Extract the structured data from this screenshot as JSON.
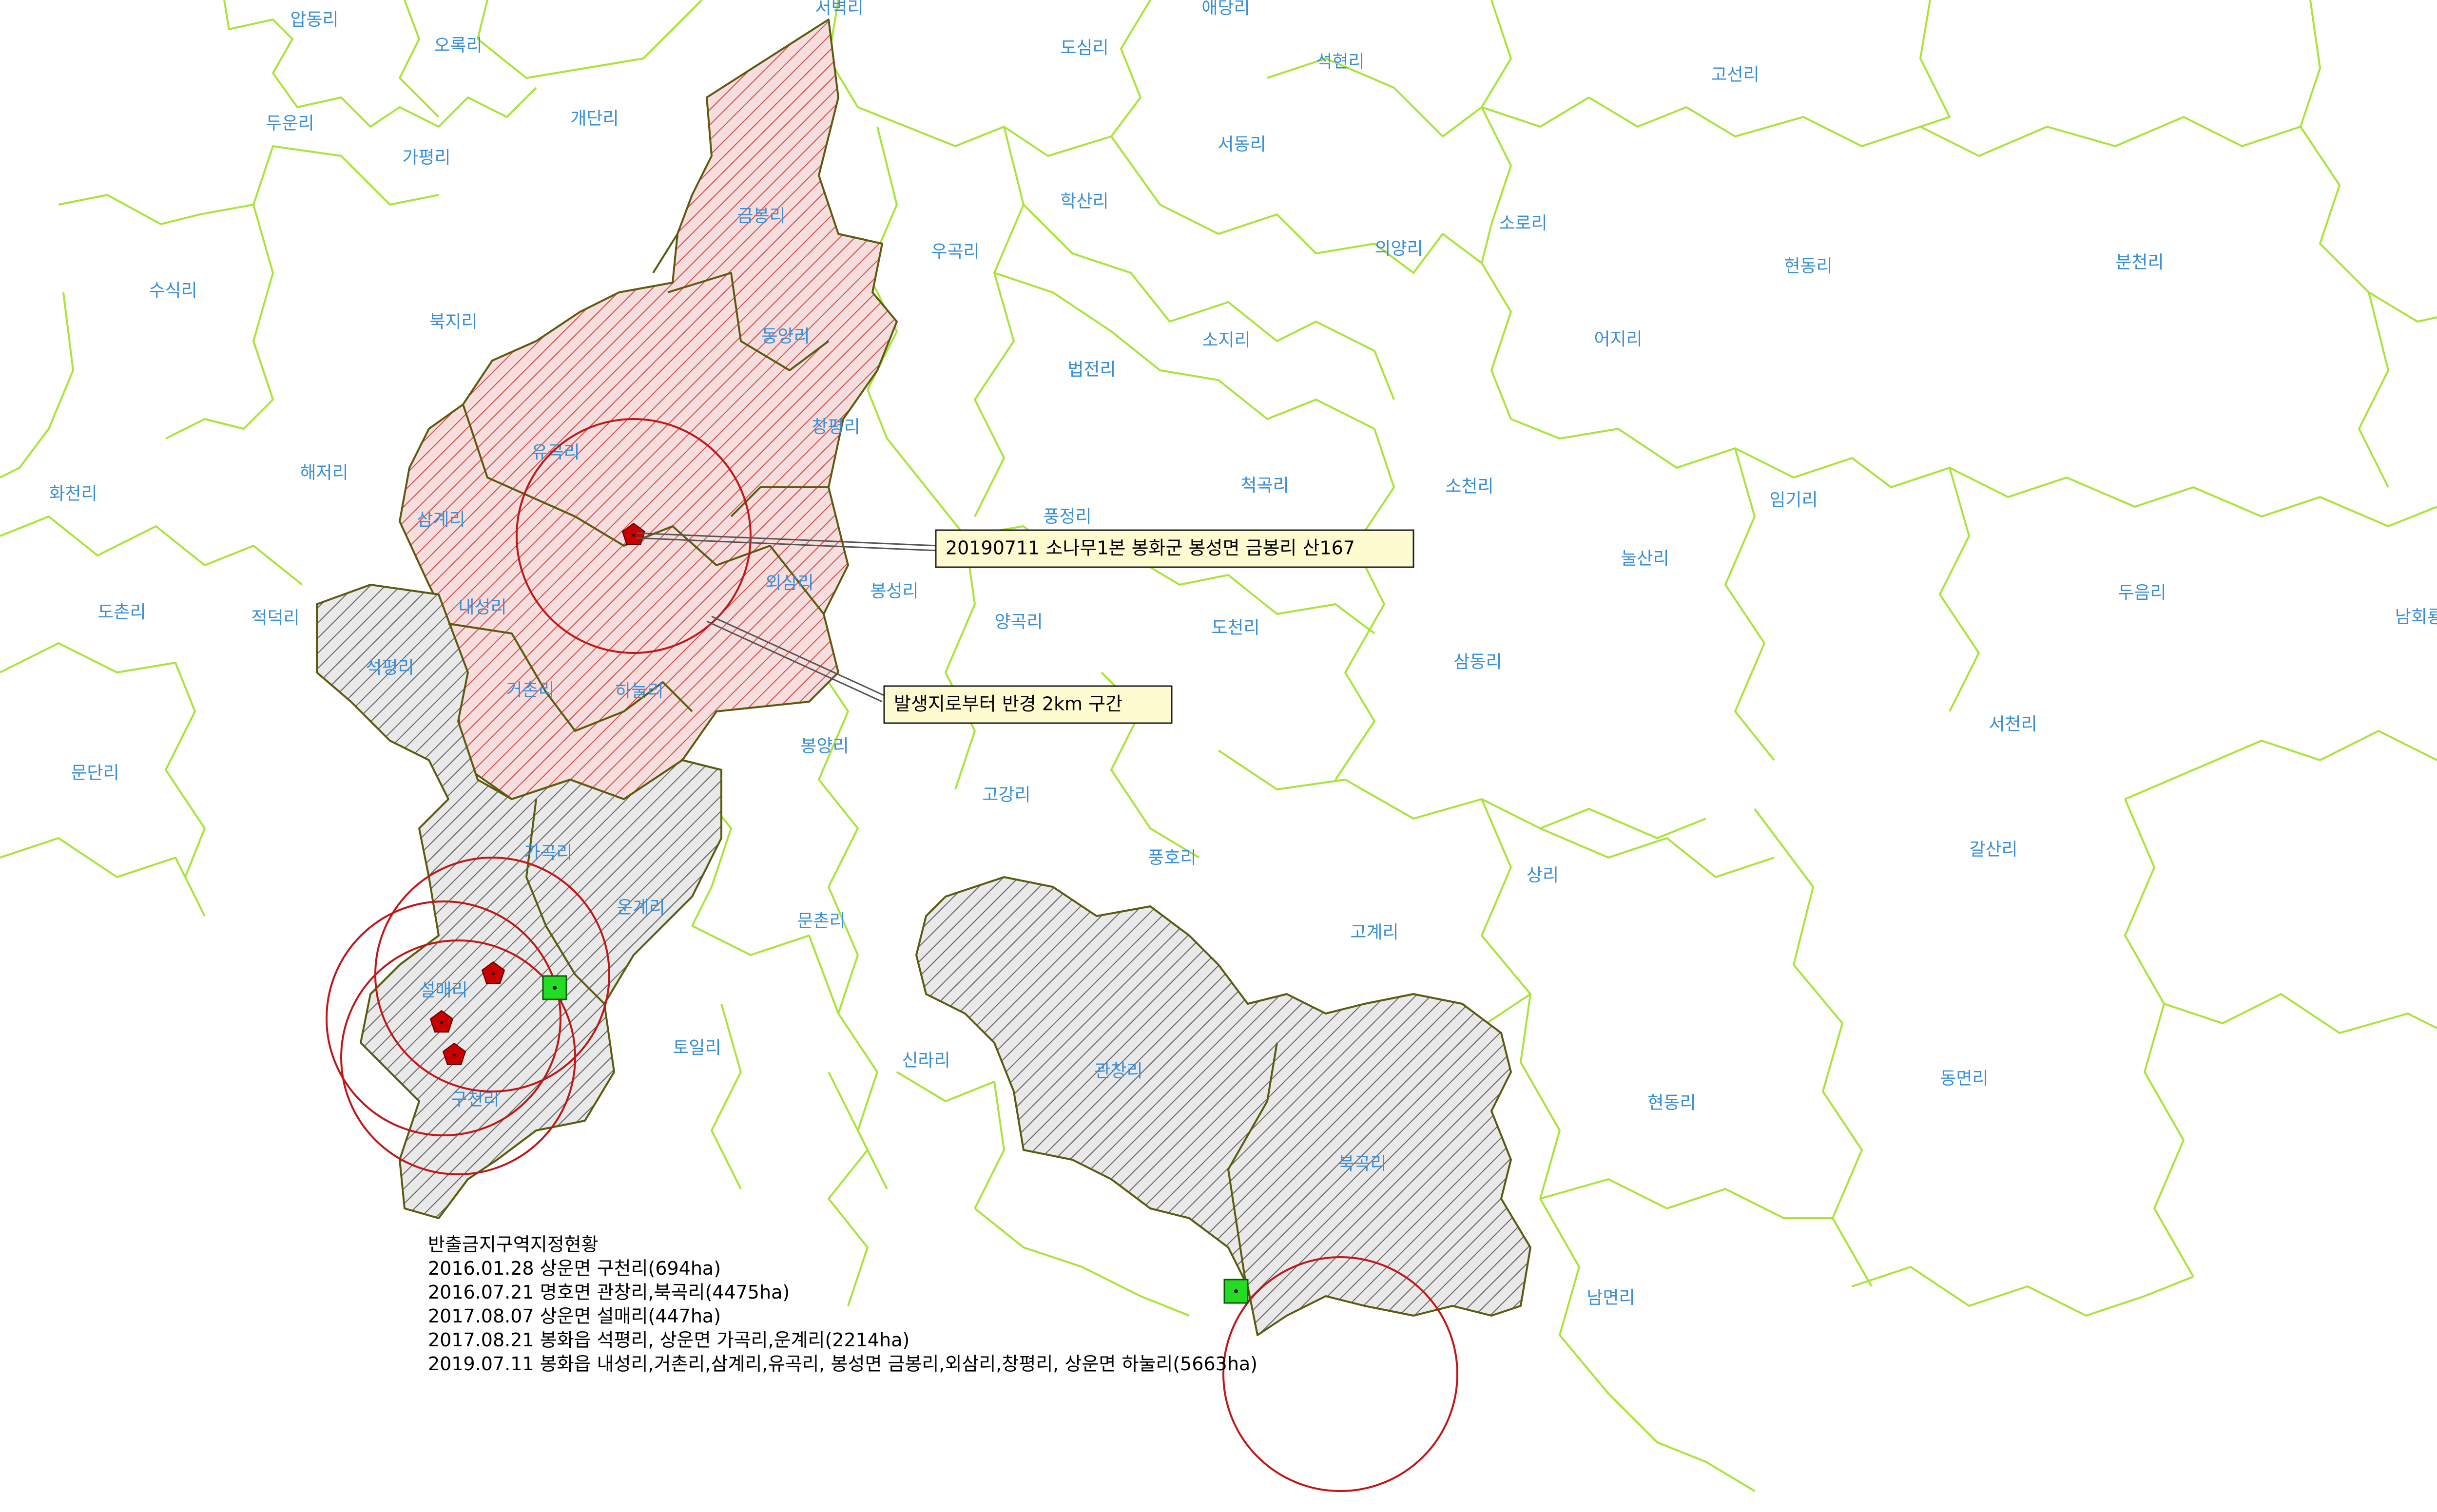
{
  "colors": {
    "boundary": "#a8e43a",
    "hatch_red_fill": "#d84a4a",
    "hatch_red_bg": "#f7dede",
    "hatch_gray_fill": "#666666",
    "hatch_gray_bg": "#e9e9e9",
    "zone_outline": "#5b5b10",
    "radius_circle": "#c01818",
    "occurrence_marker": "#c80000",
    "sample_marker": "#22dd22",
    "village_label": "#3a8fd6"
  },
  "icons": {
    "occurrence": "red-pentagon-icon",
    "sample": "green-square-icon"
  },
  "village_labels": [
    "압동리",
    "오록리",
    "두운리",
    "가평리",
    "개단리",
    "서벽리",
    "애당리",
    "도심리",
    "석현리",
    "서동리",
    "고선리",
    "학산리",
    "우곡리",
    "의양리",
    "소로리",
    "현동리",
    "분천리",
    "수식리",
    "북지리",
    "금봉리",
    "동양리",
    "법전리",
    "소지리",
    "어지리",
    "화천리",
    "해저리",
    "유곡리",
    "창평리",
    "척곡리",
    "소천리",
    "임기리",
    "삼계리",
    "풍정리",
    "도촌리",
    "적덕리",
    "내성리",
    "외삼리",
    "봉성리",
    "양곡리",
    "도천리",
    "눌산리",
    "두음리",
    "남회룡리",
    "석평리",
    "거촌리",
    "하눌리",
    "삼동리",
    "문단리",
    "봉양리",
    "고강리",
    "서천리",
    "가곡리",
    "풍호리",
    "갈산리",
    "운계리",
    "문촌리",
    "상리",
    "고계리",
    "설매리",
    "토일리",
    "신라리",
    "관창리",
    "현동리",
    "동면리",
    "구천리",
    "북곡리",
    "남면리"
  ],
  "callouts": [
    {
      "text": "20190711 소나무1본 봉화군 봉성면 금봉리 산167"
    },
    {
      "text": "발생지로부터 반경 2km 구간"
    }
  ],
  "legend": {
    "title": "반출금지구역지정현황",
    "entries": [
      "2016.01.28 상운면 구천리(694ha)",
      "2016.07.21 명호면 관창리,북곡리(4475ha)",
      "2017.08.07 상운면 설매리(447ha)",
      "2017.08.21 봉화읍 석평리, 상운면 가곡리,운계리(2214ha)",
      "2019.07.11 봉화읍 내성리,거촌리,삼계리,유곡리, 봉성면 금봉리,외삼리,창평리, 상운면 하눌리(5663ha)"
    ]
  }
}
